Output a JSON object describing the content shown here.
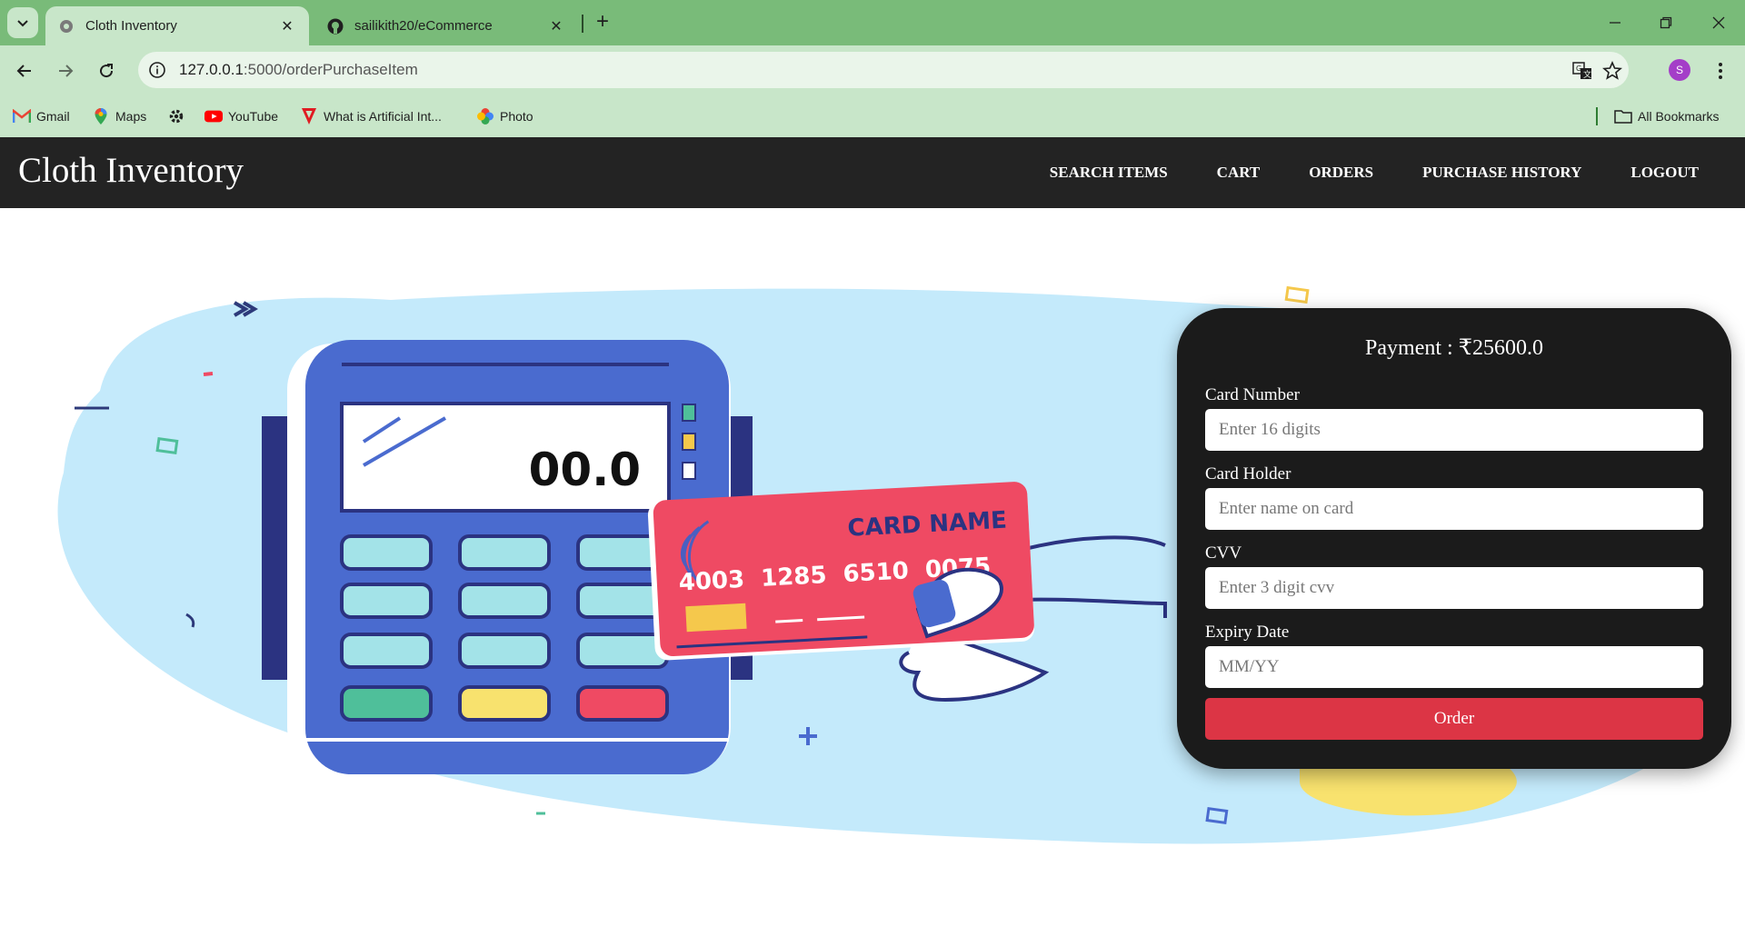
{
  "browser": {
    "tabs": [
      {
        "title": "Cloth Inventory",
        "active": true
      },
      {
        "title": "sailikith20/eCommerce",
        "active": false
      }
    ],
    "url_host": "127.0.0.1",
    "url_path": ":5000/orderPurchaseItem",
    "bookmarks": [
      {
        "label": "Gmail",
        "icon": "gmail-icon"
      },
      {
        "label": "Maps",
        "icon": "maps-icon"
      },
      {
        "label": "",
        "icon": "gear-icon"
      },
      {
        "label": "YouTube",
        "icon": "youtube-icon"
      },
      {
        "label": "What is Artificial Int...",
        "icon": "bookmark-favicon-icon"
      },
      {
        "label": "Photo",
        "icon": "photos-icon"
      }
    ],
    "all_bookmarks": "All Bookmarks",
    "profile_initial": "S"
  },
  "navbar": {
    "brand": "Cloth Inventory",
    "links": [
      "SEARCH ITEMS",
      "CART",
      "ORDERS",
      "PURCHASE HISTORY",
      "LOGOUT"
    ]
  },
  "illustration": {
    "terminal_display": "00.0",
    "card_name": "CARD NAME",
    "card_number": "4003  1285  6510  0075"
  },
  "payment": {
    "title": "Payment : ₹25600.0",
    "card_number_label": "Card Number",
    "card_number_placeholder": "Enter 16 digits",
    "card_holder_label": "Card Holder",
    "card_holder_placeholder": "Enter name on card",
    "cvv_label": "CVV",
    "cvv_placeholder": "Enter 3 digit cvv",
    "expiry_label": "Expiry Date",
    "expiry_placeholder": "MM/YY",
    "order_button": "Order"
  },
  "colors": {
    "tabstrip": "#79bb79",
    "toolbar": "#c8e6c9",
    "navbar": "#232323",
    "order_button": "#dc3545",
    "terminal_blue": "#4a6bcf",
    "card_red": "#ef4a63",
    "blob": "#c4eafb"
  }
}
